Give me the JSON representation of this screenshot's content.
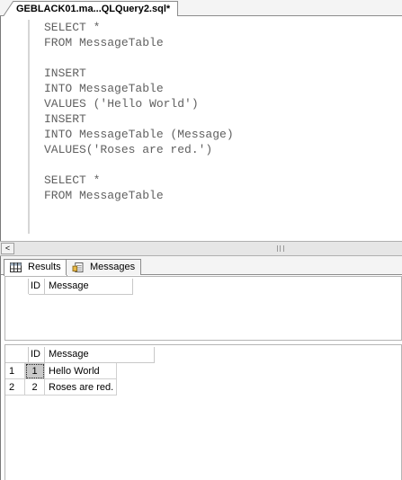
{
  "document_tab": {
    "title": "GEBLACK01.ma...QLQuery2.sql*"
  },
  "editor": {
    "lines": [
      "SELECT *",
      "FROM MessageTable",
      "",
      "INSERT",
      "INTO MessageTable",
      "VALUES ('Hello World')",
      "INSERT",
      "INTO MessageTable (Message)",
      "VALUES('Roses are red.')",
      "",
      "SELECT *",
      "FROM MessageTable"
    ]
  },
  "scrollbar": {
    "left_arrow": "<"
  },
  "results_tabs": [
    {
      "label": "Results",
      "icon": "grid-icon"
    },
    {
      "label": "Messages",
      "icon": "messages-icon"
    }
  ],
  "result_set_1": {
    "columns": [
      "ID",
      "Message"
    ],
    "rows": []
  },
  "result_set_2": {
    "columns": [
      "ID",
      "Message"
    ],
    "rows": [
      {
        "row": "1",
        "id": "1",
        "message": "Hello World"
      },
      {
        "row": "2",
        "id": "2",
        "message": "Roses are red."
      }
    ]
  }
}
